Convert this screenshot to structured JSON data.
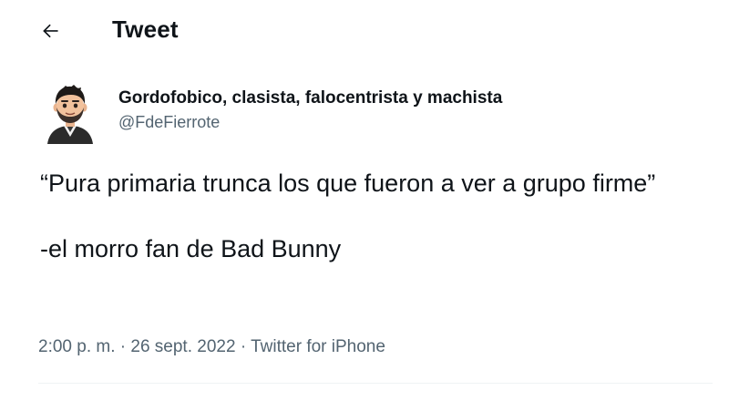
{
  "header": {
    "title": "Tweet",
    "back_icon": "arrow-left-icon"
  },
  "author": {
    "display_name": "Gordofobico, clasista, falocentrista y machista",
    "handle": "@FdeFierrote",
    "avatar_icon": "cartoon-avatar"
  },
  "tweet": {
    "text": "“Pura primaria trunca los que fueron a ver a grupo firme”\n\n-el morro fan de Bad Bunny"
  },
  "meta": {
    "time": "2:00 p. m.",
    "separator_1": " · ",
    "date": "26 sept. 2022",
    "separator_2": " · ",
    "source": "Twitter for iPhone"
  },
  "colors": {
    "text_primary": "#0f1419",
    "text_secondary": "#536471",
    "divider": "#eff3f4",
    "background": "#ffffff"
  }
}
